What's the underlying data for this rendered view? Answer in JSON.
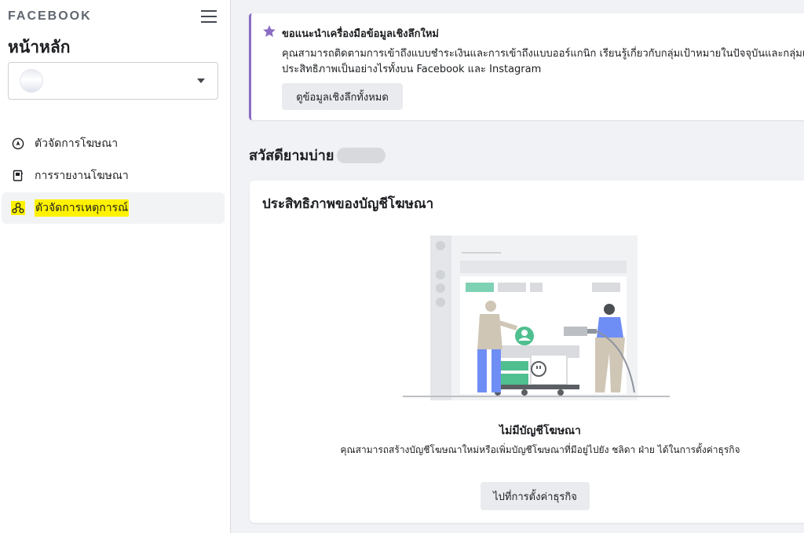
{
  "brand": "FACEBOOK",
  "sidebar": {
    "page_title": "หน้าหลัก",
    "nav": [
      {
        "label": "ตัวจัดการโฆษณา",
        "icon": "compass-icon",
        "active": false
      },
      {
        "label": "การรายงานโฆษณา",
        "icon": "report-book-icon",
        "active": false
      },
      {
        "label": "ตัวจัดการเหตุการณ์",
        "icon": "events-network-icon",
        "active": true
      }
    ]
  },
  "insights": {
    "title": "ขอแนะนำเครื่องมือข้อมูลเชิงลึกใหม่",
    "body_line1": "คุณสามารถติดตามการเข้าถึงแบบชำระเงินและการเข้าถึงแบบออร์แกนิก เรียนรู้เกี่ยวกับกลุ่มเป้าหมายในปัจจุบันและกลุ่มเ",
    "body_line2": "ประสิทธิภาพเป็นอย่างไรทั้งบน Facebook และ Instagram",
    "button": "ดูข้อมูลเชิงลึกทั้งหมด",
    "accent": "#8a6cc4"
  },
  "greeting": "สวัสดียามบ่าย",
  "performance": {
    "title": "ประสิทธิภาพของบัญชีโฆษณา",
    "empty_title": "ไม่มีบัญชีโฆษณา",
    "empty_desc": "คุณสามารถสร้างบัญชีโฆษณาใหม่หรือเพิ่มบัญชีโฆษณาที่มีอยู่ไปยัง ชลิดา ฝ่าย ได้ในการตั้งค่าธุรกิจ",
    "button": "ไปที่การตั้งค่าธุรกิจ"
  }
}
